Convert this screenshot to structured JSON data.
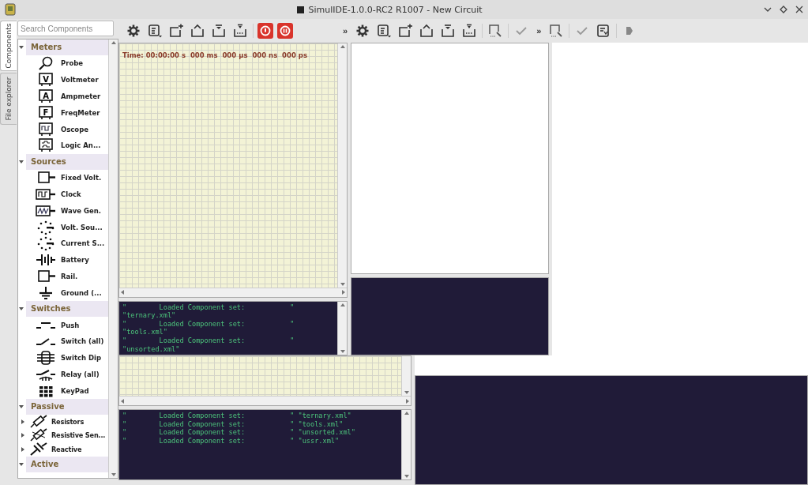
{
  "window": {
    "title": "SimulIDE-1.0.0-RC2 R1007 - New Circuit"
  },
  "side_tabs": [
    {
      "label": "Components",
      "selected": true
    },
    {
      "label": "File explorer",
      "selected": false
    }
  ],
  "search": {
    "placeholder": "Search Components"
  },
  "components": [
    {
      "label": "Meters",
      "expanded": true,
      "children": [
        {
          "label": "Probe",
          "kind": "probe"
        },
        {
          "label": "Voltmeter",
          "kind": "meter",
          "symbol": "V"
        },
        {
          "label": "Ampmeter",
          "kind": "meter",
          "symbol": "A"
        },
        {
          "label": "FreqMeter",
          "kind": "meter",
          "symbol": "F"
        },
        {
          "label": "Oscope",
          "kind": "scope"
        },
        {
          "label": "Logic An...",
          "kind": "logic"
        }
      ]
    },
    {
      "label": "Sources",
      "expanded": true,
      "children": [
        {
          "label": "Fixed Volt.",
          "kind": "fixed"
        },
        {
          "label": "Clock",
          "kind": "clock"
        },
        {
          "label": "Wave Gen.",
          "kind": "wave"
        },
        {
          "label": "Volt. Sou...",
          "kind": "source"
        },
        {
          "label": "Current S...",
          "kind": "source"
        },
        {
          "label": "Battery",
          "kind": "battery"
        },
        {
          "label": "Rail.",
          "kind": "fixed"
        },
        {
          "label": "Ground (...",
          "kind": "ground"
        }
      ]
    },
    {
      "label": "Switches",
      "expanded": true,
      "children": [
        {
          "label": "Push",
          "kind": "push"
        },
        {
          "label": "Switch (all)",
          "kind": "switch"
        },
        {
          "label": "Switch Dip",
          "kind": "dip"
        },
        {
          "label": "Relay (all)",
          "kind": "relay"
        },
        {
          "label": "KeyPad",
          "kind": "keypad"
        }
      ]
    },
    {
      "label": "Passive",
      "expanded": true,
      "children": [
        {
          "label": "Resistors",
          "kind": "resistor",
          "expanded": false
        },
        {
          "label": "Resistive Sen...",
          "kind": "sensor",
          "expanded": false
        },
        {
          "label": "Reactive",
          "kind": "reactive",
          "expanded": false
        }
      ]
    },
    {
      "label": "Active",
      "expanded": true
    }
  ],
  "toolbar": [
    {
      "kind": "settings"
    },
    {
      "kind": "list"
    },
    {
      "kind": "new"
    },
    {
      "kind": "open"
    },
    {
      "kind": "save"
    },
    {
      "kind": "saveas"
    },
    {
      "kind": "sep"
    },
    {
      "kind": "power"
    },
    {
      "kind": "pause"
    },
    {
      "kind": "gap"
    },
    {
      "kind": "more",
      "label": "»"
    },
    {
      "kind": "settings"
    },
    {
      "kind": "list"
    },
    {
      "kind": "new"
    },
    {
      "kind": "open"
    },
    {
      "kind": "save"
    },
    {
      "kind": "saveas"
    },
    {
      "kind": "sep"
    },
    {
      "kind": "find"
    },
    {
      "kind": "sep"
    },
    {
      "kind": "check"
    },
    {
      "kind": "more",
      "label": "»"
    },
    {
      "kind": "find"
    },
    {
      "kind": "sep"
    },
    {
      "kind": "check"
    },
    {
      "kind": "doc"
    },
    {
      "kind": "sep"
    },
    {
      "kind": "run"
    }
  ],
  "circuit": {
    "time": "Time: 00:00:00 s  000 ms  000 µs  000 ns  000 ps"
  },
  "console_top": [
    "\"        Loaded Component set:           \"",
    "\"ternary.xml\"",
    "\"        Loaded Component set:           \"",
    "\"tools.xml\"",
    "\"        Loaded Component set:           \"",
    "\"unsorted.xml\""
  ],
  "console_bottom": [
    "\"        Loaded Component set:           \" \"ternary.xml\"",
    "\"        Loaded Component set:           \" \"tools.xml\"",
    "\"        Loaded Component set:           \" \"unsorted.xml\"",
    "\"        Loaded Component set:           \" \"ussr.xml\""
  ]
}
